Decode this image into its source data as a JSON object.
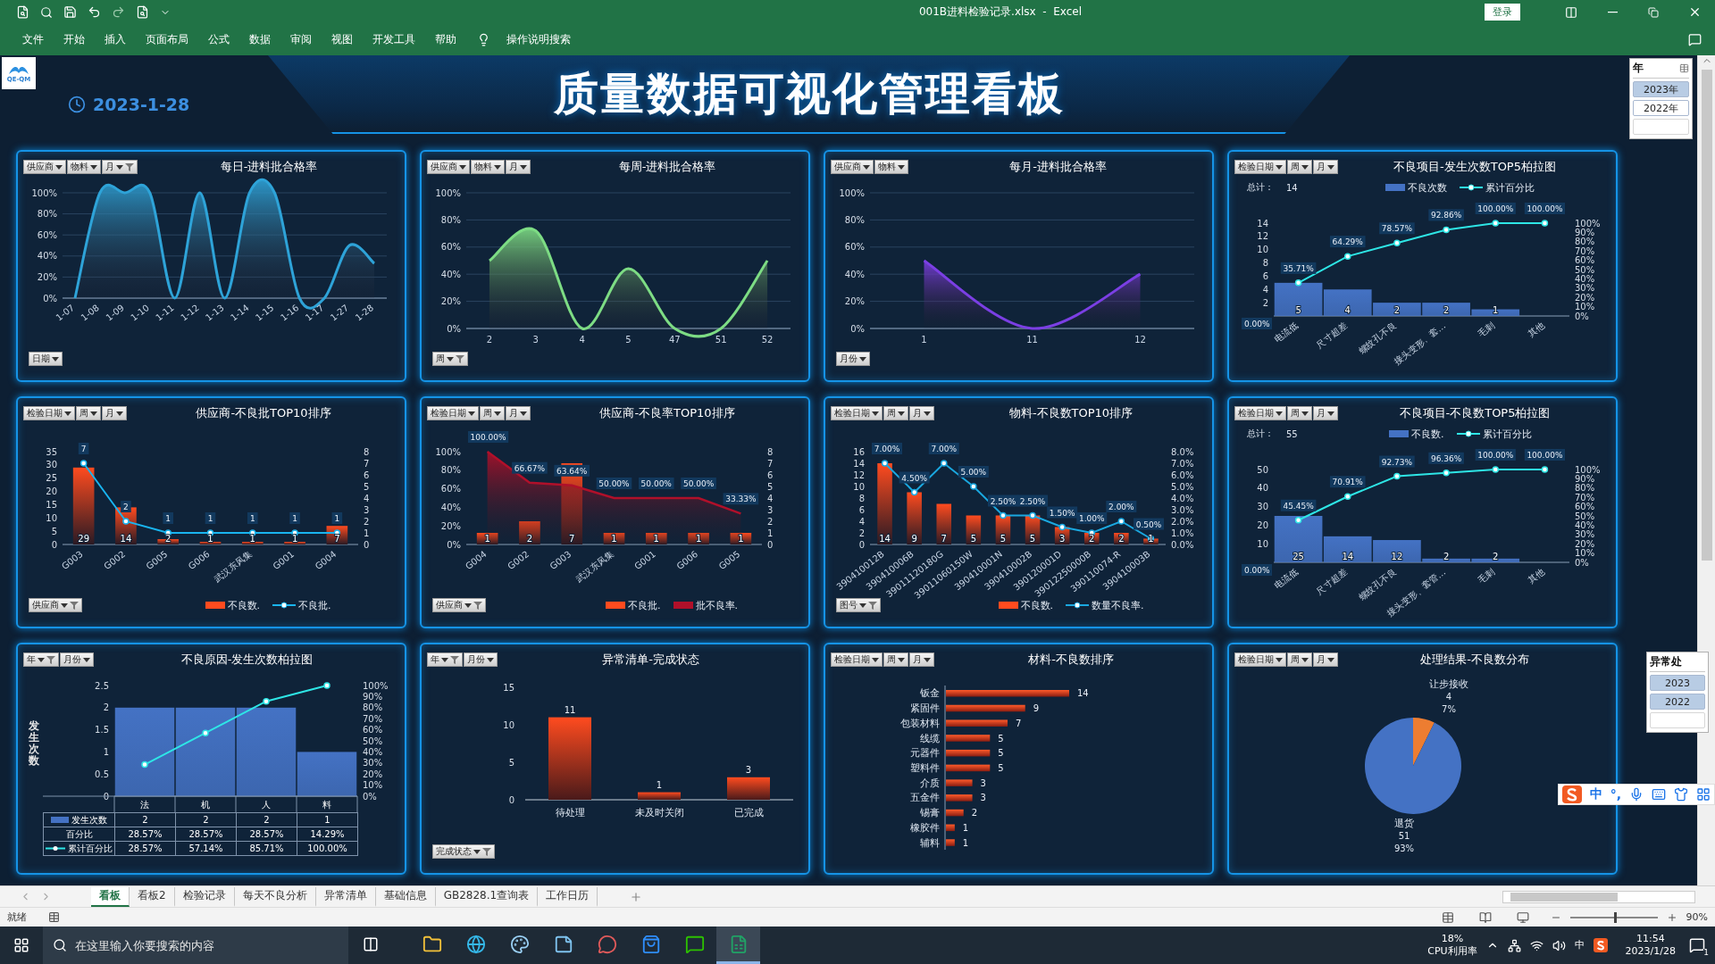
{
  "window": {
    "title": "001B进料检验记录.xlsx  -  Excel",
    "login": "登录"
  },
  "menu": [
    "文件",
    "开始",
    "插入",
    "页面布局",
    "公式",
    "数据",
    "审阅",
    "视图",
    "开发工具",
    "帮助"
  ],
  "tell_me": "操作说明搜索",
  "dashboard": {
    "logo": "QE-QM",
    "date": "2023-1-28",
    "title": "质量数据可视化管理看板"
  },
  "slicers": [
    {
      "title": "年",
      "items": [
        {
          "label": "2023年",
          "selected": true
        },
        {
          "label": "2022年",
          "selected": false
        }
      ]
    },
    {
      "title": "异常处",
      "items": [
        {
          "label": "2023",
          "selected": true
        },
        {
          "label": "2022",
          "selected": true
        }
      ]
    }
  ],
  "panels": [
    {
      "kind": "combo",
      "title": "每日-进料批合格率",
      "filters": [
        {
          "label": "供应商",
          "filtered": false
        },
        {
          "label": "物料",
          "filtered": false
        },
        {
          "label": "月",
          "filtered": true
        }
      ],
      "bottom_filter": {
        "label": "日期",
        "filtered": false
      },
      "chart_data": {
        "type": "area",
        "grid": true,
        "categories": [
          "1-07",
          "1-08",
          "1-09",
          "1-10",
          "1-11",
          "1-12",
          "1-13",
          "1-14",
          "1-15",
          "1-16",
          "1-17",
          "1-27",
          "1-28"
        ],
        "ylim": [
          0,
          100
        ],
        "yticks": [
          {
            "value": 0,
            "label": "0%"
          },
          {
            "value": 20,
            "label": "20%"
          },
          {
            "value": 40,
            "label": "40%"
          },
          {
            "value": 60,
            "label": "60%"
          },
          {
            "value": 80,
            "label": "80%"
          },
          {
            "value": 100,
            "label": "100%"
          }
        ],
        "series": [
          {
            "type": "area",
            "color": "#2ea3d8",
            "values": [
              0,
              100,
              100,
              100,
              0,
              100,
              0,
              100,
              100,
              0,
              0,
              50,
              33
            ]
          }
        ]
      }
    },
    {
      "kind": "combo",
      "title": "每周-进料批合格率",
      "filters": [
        {
          "label": "供应商",
          "filtered": false
        },
        {
          "label": "物料",
          "filtered": false
        },
        {
          "label": "月",
          "filtered": false
        }
      ],
      "bottom_filter": {
        "label": "周",
        "filtered": true
      },
      "chart_data": {
        "type": "area",
        "grid": true,
        "categories": [
          "2",
          "3",
          "4",
          "5",
          "47",
          "51",
          "52"
        ],
        "ylim": [
          0,
          100
        ],
        "yticks": [
          {
            "value": 0,
            "label": "0%"
          },
          {
            "value": 20,
            "label": "20%"
          },
          {
            "value": 40,
            "label": "40%"
          },
          {
            "value": 60,
            "label": "60%"
          },
          {
            "value": 80,
            "label": "80%"
          },
          {
            "value": 100,
            "label": "100%"
          }
        ],
        "series": [
          {
            "type": "area",
            "color": "#7ddc84",
            "values": [
              50,
              72,
              0,
              44,
              0,
              0,
              50
            ]
          }
        ]
      }
    },
    {
      "kind": "combo",
      "title": "每月-进料批合格率",
      "filters": [
        {
          "label": "供应商",
          "filtered": false
        },
        {
          "label": "物料",
          "filtered": false
        }
      ],
      "bottom_filter": {
        "label": "月份",
        "filtered": false
      },
      "chart_data": {
        "type": "area",
        "grid": true,
        "categories": [
          "1",
          "11",
          "12"
        ],
        "ylim": [
          0,
          100
        ],
        "yticks": [
          {
            "value": 0,
            "label": "0%"
          },
          {
            "value": 20,
            "label": "20%"
          },
          {
            "value": 40,
            "label": "40%"
          },
          {
            "value": 60,
            "label": "60%"
          },
          {
            "value": 80,
            "label": "80%"
          },
          {
            "value": 100,
            "label": "100%"
          }
        ],
        "series": [
          {
            "type": "area",
            "color": "#7b3fe4",
            "values": [
              50,
              0,
              40
            ]
          }
        ]
      }
    },
    {
      "kind": "combo",
      "title": "不良项目-发生次数TOP5柏拉图",
      "filters": [
        {
          "label": "检验日期",
          "filtered": false
        },
        {
          "label": "周",
          "filtered": false
        },
        {
          "label": "月",
          "filtered": false
        }
      ],
      "summary": {
        "label": "总计：",
        "value": "14"
      },
      "chart_data": {
        "type": "bar",
        "data_labels": true,
        "categories": [
          "电流低",
          "尺寸超差",
          "螺纹孔不良",
          "接头变形、套…",
          "毛刺",
          "其他"
        ],
        "ylim": [
          0,
          14
        ],
        "yticks": [
          {
            "value": 2,
            "label": "2"
          },
          {
            "value": 4,
            "label": "4"
          },
          {
            "value": 6,
            "label": "6"
          },
          {
            "value": 8,
            "label": "8"
          },
          {
            "value": 10,
            "label": "10"
          },
          {
            "value": 12,
            "label": "12"
          },
          {
            "value": 14,
            "label": "14"
          }
        ],
        "y2lim": [
          0,
          100
        ],
        "y2ticks": [
          {
            "value": 0,
            "label": "0%"
          },
          {
            "value": 10,
            "label": "10%"
          },
          {
            "value": 20,
            "label": "20%"
          },
          {
            "value": 30,
            "label": "30%"
          },
          {
            "value": 40,
            "label": "40%"
          },
          {
            "value": 50,
            "label": "50%"
          },
          {
            "value": 60,
            "label": "60%"
          },
          {
            "value": 70,
            "label": "70%"
          },
          {
            "value": 80,
            "label": "80%"
          },
          {
            "value": 90,
            "label": "90%"
          },
          {
            "value": 100,
            "label": "100%"
          }
        ],
        "series": [
          {
            "name": "不良次数",
            "type": "bar",
            "color": "#4472c4",
            "values": [
              5,
              4,
              2,
              2,
              1,
              null
            ]
          },
          {
            "name": "累计百分比",
            "type": "line",
            "axis": "y2",
            "marker": true,
            "color": "#2ee6e6",
            "values": [
              35.71,
              64.29,
              78.57,
              92.86,
              100,
              100
            ],
            "value_labels": [
              "35.71%",
              "64.29%",
              "78.57%",
              "92.86%",
              "100.00%",
              "100.00%"
            ]
          }
        ],
        "annotations": [
          "0.00%"
        ]
      }
    },
    {
      "kind": "combo",
      "title": "供应商-不良批TOP10排序",
      "filters": [
        {
          "label": "检验日期",
          "filtered": false
        },
        {
          "label": "周",
          "filtered": false
        },
        {
          "label": "月",
          "filtered": false
        }
      ],
      "bottom_filter": {
        "label": "供应商",
        "filtered": true
      },
      "chart_data": {
        "type": "bar",
        "data_labels": true,
        "categories": [
          "G003",
          "G002",
          "G005",
          "G006",
          "武汉东风集",
          "G001",
          "G004"
        ],
        "ylim": [
          0,
          35
        ],
        "yticks": [
          {
            "value": 0,
            "label": "0"
          },
          {
            "value": 5,
            "label": "5"
          },
          {
            "value": 10,
            "label": "10"
          },
          {
            "value": 15,
            "label": "15"
          },
          {
            "value": 20,
            "label": "20"
          },
          {
            "value": 25,
            "label": "25"
          },
          {
            "value": 30,
            "label": "30"
          },
          {
            "value": 35,
            "label": "35"
          }
        ],
        "y2lim": [
          0,
          8
        ],
        "y2ticks": [
          {
            "value": 0,
            "label": "0"
          },
          {
            "value": 1,
            "label": "1"
          },
          {
            "value": 2,
            "label": "2"
          },
          {
            "value": 3,
            "label": "3"
          },
          {
            "value": 4,
            "label": "4"
          },
          {
            "value": 5,
            "label": "5"
          },
          {
            "value": 6,
            "label": "6"
          },
          {
            "value": 7,
            "label": "7"
          },
          {
            "value": 8,
            "label": "8"
          }
        ],
        "series": [
          {
            "name": "不良数.",
            "type": "bar",
            "color": "#ff4b1f",
            "values": [
              29,
              14,
              2,
              1,
              1,
              1,
              7
            ]
          },
          {
            "name": "不良批.",
            "type": "line",
            "axis": "y2",
            "marker": true,
            "color": "#19b5f0",
            "values": [
              7,
              2,
              1,
              1,
              1,
              1,
              1
            ]
          }
        ]
      }
    },
    {
      "kind": "combo",
      "title": "供应商-不良率TOP10排序",
      "filters": [
        {
          "label": "检验日期",
          "filtered": false
        },
        {
          "label": "周",
          "filtered": false
        },
        {
          "label": "月",
          "filtered": false
        }
      ],
      "bottom_filter": {
        "label": "供应商",
        "filtered": true
      },
      "chart_data": {
        "type": "bar",
        "data_labels": true,
        "categories": [
          "G004",
          "G002",
          "G003",
          "武汉东风集",
          "G001",
          "G006",
          "G005"
        ],
        "ylim": [
          0,
          100
        ],
        "yticks": [
          {
            "value": 0,
            "label": "0%"
          },
          {
            "value": 20,
            "label": "20%"
          },
          {
            "value": 40,
            "label": "40%"
          },
          {
            "value": 60,
            "label": "60%"
          },
          {
            "value": 80,
            "label": "80%"
          },
          {
            "value": 100,
            "label": "100%"
          }
        ],
        "y2lim": [
          0,
          8
        ],
        "y2ticks": [
          {
            "value": 0,
            "label": "0"
          },
          {
            "value": 1,
            "label": "1"
          },
          {
            "value": 2,
            "label": "2"
          },
          {
            "value": 3,
            "label": "3"
          },
          {
            "value": 4,
            "label": "4"
          },
          {
            "value": 5,
            "label": "5"
          },
          {
            "value": 6,
            "label": "6"
          },
          {
            "value": 7,
            "label": "7"
          },
          {
            "value": 8,
            "label": "8"
          }
        ],
        "series": [
          {
            "name": "不良批.",
            "type": "bar",
            "axis": "y2",
            "color": "#ff4b1f",
            "values": [
              1,
              2,
              7,
              1,
              1,
              1,
              1
            ]
          },
          {
            "name": "批不良率.",
            "type": "area",
            "color": "#b0102a",
            "values": [
              100,
              66.67,
              63.64,
              50,
              50,
              50,
              33.33
            ],
            "value_labels": [
              "100.00%",
              "66.67%",
              "63.64%",
              "50.00%",
              "50.00%",
              "50.00%",
              "33.33%"
            ]
          }
        ]
      }
    },
    {
      "kind": "combo",
      "title": "物料-不良数TOP10排序",
      "filters": [
        {
          "label": "检验日期",
          "filtered": false
        },
        {
          "label": "周",
          "filtered": false
        },
        {
          "label": "月",
          "filtered": false
        }
      ],
      "bottom_filter": {
        "label": "图号",
        "filtered": true
      },
      "chart_data": {
        "type": "bar",
        "data_labels": true,
        "categories": [
          "390410012B",
          "390410006B",
          "39011120180G",
          "39011060150W",
          "390410001N",
          "390410002B",
          "390120001D",
          "39012250000B",
          "390110074-R",
          "390410003B"
        ],
        "ylim": [
          0,
          16
        ],
        "yticks": [
          {
            "value": 0,
            "label": "0"
          },
          {
            "value": 2,
            "label": "2"
          },
          {
            "value": 4,
            "label": "4"
          },
          {
            "value": 6,
            "label": "6"
          },
          {
            "value": 8,
            "label": "8"
          },
          {
            "value": 10,
            "label": "10"
          },
          {
            "value": 12,
            "label": "12"
          },
          {
            "value": 14,
            "label": "14"
          },
          {
            "value": 16,
            "label": "16"
          }
        ],
        "y2lim": [
          0,
          8
        ],
        "y2ticks": [
          {
            "value": 0,
            "label": "0.0%"
          },
          {
            "value": 1,
            "label": "1.0%"
          },
          {
            "value": 2,
            "label": "2.0%"
          },
          {
            "value": 3,
            "label": "3.0%"
          },
          {
            "value": 4,
            "label": "4.0%"
          },
          {
            "value": 5,
            "label": "5.0%"
          },
          {
            "value": 6,
            "label": "6.0%"
          },
          {
            "value": 7,
            "label": "7.0%"
          },
          {
            "value": 8,
            "label": "8.0%"
          }
        ],
        "series": [
          {
            "name": "不良数.",
            "type": "bar",
            "color": "#ff4b1f",
            "values": [
              14,
              9,
              7,
              5,
              5,
              5,
              3,
              2,
              2,
              1
            ]
          },
          {
            "name": "数量不良率.",
            "type": "line",
            "axis": "y2",
            "marker": true,
            "color": "#1aa8e0",
            "values": [
              7,
              4.5,
              7,
              5,
              2.5,
              2.5,
              1.5,
              1,
              2,
              0.5
            ],
            "value_labels": [
              "7.00%",
              "4.50%",
              "7.00%",
              "5.00%",
              "2.50%",
              "2.50%",
              "1.50%",
              "1.00%",
              "2.00%",
              "0.50%"
            ]
          }
        ]
      }
    },
    {
      "kind": "combo",
      "title": "不良项目-不良数TOP5柏拉图",
      "filters": [
        {
          "label": "检验日期",
          "filtered": false
        },
        {
          "label": "周",
          "filtered": false
        },
        {
          "label": "月",
          "filtered": false
        }
      ],
      "summary": {
        "label": "总计：",
        "value": "55"
      },
      "chart_data": {
        "type": "bar",
        "data_labels": true,
        "categories": [
          "电流低",
          "尺寸超差",
          "螺纹孔不良",
          "接头变形、套管…",
          "毛刺",
          "其他"
        ],
        "ylim": [
          0,
          50
        ],
        "yticks": [
          {
            "value": 10,
            "label": "10"
          },
          {
            "value": 20,
            "label": "20"
          },
          {
            "value": 30,
            "label": "30"
          },
          {
            "value": 40,
            "label": "40"
          },
          {
            "value": 50,
            "label": "50"
          }
        ],
        "y2lim": [
          0,
          100
        ],
        "y2ticks": [
          {
            "value": 0,
            "label": "0%"
          },
          {
            "value": 10,
            "label": "10%"
          },
          {
            "value": 20,
            "label": "20%"
          },
          {
            "value": 30,
            "label": "30%"
          },
          {
            "value": 40,
            "label": "40%"
          },
          {
            "value": 50,
            "label": "50%"
          },
          {
            "value": 60,
            "label": "60%"
          },
          {
            "value": 70,
            "label": "70%"
          },
          {
            "value": 80,
            "label": "80%"
          },
          {
            "value": 90,
            "label": "90%"
          },
          {
            "value": 100,
            "label": "100%"
          }
        ],
        "series": [
          {
            "name": "不良数.",
            "type": "bar",
            "color": "#4472c4",
            "values": [
              25,
              14,
              12,
              2,
              2,
              null
            ]
          },
          {
            "name": "累计百分比",
            "type": "line",
            "axis": "y2",
            "marker": true,
            "color": "#2ee6e6",
            "values": [
              45.45,
              70.91,
              92.73,
              96.36,
              100,
              100
            ],
            "value_labels": [
              "45.45%",
              "70.91%",
              "92.73%",
              "96.36%",
              "100.00%",
              "100.00%"
            ]
          }
        ],
        "annotations": [
          "0.00%"
        ]
      }
    },
    {
      "kind": "table-combo",
      "title": "不良原因-发生次数柏拉图",
      "filters": [
        {
          "label": "年",
          "filtered": true
        },
        {
          "label": "月份",
          "filtered": false
        }
      ],
      "chart_data": {
        "type": "bar",
        "ylabel": "发生次数",
        "categories": [
          "法",
          "机",
          "人",
          "料"
        ],
        "ylim": [
          0,
          2.5
        ],
        "yticks": [
          {
            "value": 0,
            "label": "0"
          },
          {
            "value": 0.5,
            "label": "0.5"
          },
          {
            "value": 1,
            "label": "1"
          },
          {
            "value": 1.5,
            "label": "1.5"
          },
          {
            "value": 2,
            "label": "2"
          },
          {
            "value": 2.5,
            "label": "2.5"
          }
        ],
        "y2lim": [
          0,
          100
        ],
        "y2ticks": [
          {
            "value": 0,
            "label": "0%"
          },
          {
            "value": 10,
            "label": "10%"
          },
          {
            "value": 20,
            "label": "20%"
          },
          {
            "value": 30,
            "label": "30%"
          },
          {
            "value": 40,
            "label": "40%"
          },
          {
            "value": 50,
            "label": "50%"
          },
          {
            "value": 60,
            "label": "60%"
          },
          {
            "value": 70,
            "label": "70%"
          },
          {
            "value": 80,
            "label": "80%"
          },
          {
            "value": 90,
            "label": "90%"
          },
          {
            "value": 100,
            "label": "100%"
          }
        ],
        "series": [
          {
            "name": "发生次数",
            "type": "bar",
            "color": "#4472c4",
            "values": [
              2,
              2,
              2,
              1
            ]
          },
          {
            "name": "累计百分比",
            "type": "line",
            "axis": "y2",
            "marker": true,
            "color": "#2ee6e6",
            "values": [
              28.57,
              57.14,
              85.71,
              100
            ]
          }
        ]
      },
      "data_table": [
        {
          "kind": "bar",
          "values": [
            "2",
            "2",
            "2",
            "1"
          ]
        },
        {
          "kind": "plain",
          "label": "百分比",
          "values": [
            "28.57%",
            "28.57%",
            "28.57%",
            "14.29%"
          ]
        },
        {
          "kind": "line",
          "values": [
            "28.57%",
            "57.14%",
            "85.71%",
            "100.00%"
          ]
        }
      ]
    },
    {
      "kind": "bar3d",
      "title": "异常清单-完成状态",
      "filters": [
        {
          "label": "年",
          "filtered": true
        },
        {
          "label": "月份",
          "filtered": false
        }
      ],
      "bottom_filter": {
        "label": "完成状态",
        "filtered": true
      },
      "chart_data": {
        "type": "bar",
        "data_labels": true,
        "categories": [
          "待处理",
          "未及时关闭",
          "已完成"
        ],
        "values": [
          11,
          1,
          3
        ],
        "ylim": [
          0,
          15
        ],
        "yticks": [
          0,
          5,
          10,
          15
        ]
      }
    },
    {
      "kind": "hbar",
      "title": "材料-不良数排序",
      "filters": [
        {
          "label": "检验日期",
          "filtered": false
        },
        {
          "label": "周",
          "filtered": false
        },
        {
          "label": "月",
          "filtered": false
        }
      ],
      "chart_data": {
        "type": "bar",
        "orientation": "horizontal",
        "data_labels": true,
        "categories": [
          "钣金",
          "紧固件",
          "包装材料",
          "线缆",
          "元器件",
          "塑料件",
          "介质",
          "五金件",
          "锡膏",
          "橡胶件",
          "辅料"
        ],
        "values": [
          14,
          9,
          7,
          5,
          5,
          5,
          3,
          3,
          2,
          1,
          1
        ]
      }
    },
    {
      "kind": "pie",
      "title": "处理结果-不良数分布",
      "filters": [
        {
          "label": "检验日期",
          "filtered": false
        },
        {
          "label": "周",
          "filtered": false
        },
        {
          "label": "月",
          "filtered": false
        }
      ],
      "chart_data": {
        "type": "pie",
        "data_labels": true,
        "categories": [
          "让步接收",
          "退货"
        ],
        "values": [
          4,
          51
        ],
        "colors": [
          "#ed7d31",
          "#4472c4"
        ],
        "value_labels": [
          "4",
          "51"
        ],
        "annotations": [
          {
            "text": "7%"
          },
          {
            "text": "93%"
          }
        ]
      }
    }
  ],
  "sheet_tabs": [
    {
      "label": "看板",
      "selected": true
    },
    {
      "label": "看板2",
      "selected": false
    },
    {
      "label": "检验记录",
      "selected": false
    },
    {
      "label": "每天不良分析",
      "selected": false
    },
    {
      "label": "异常清单",
      "selected": false
    },
    {
      "label": "基础信息",
      "selected": false
    },
    {
      "label": "GB2828.1查询表",
      "selected": false
    },
    {
      "label": "工作日历",
      "selected": false
    }
  ],
  "status_bar": {
    "status": "就绪",
    "zoom": {
      "level": 0.5,
      "reading": "90%"
    }
  },
  "ime": {
    "mode": "中",
    "punctuation": "°,"
  },
  "taskbar": {
    "search_placeholder": "在这里输入你要搜索的内容",
    "apps": [
      {
        "kind": "folder",
        "selected": false
      },
      {
        "kind": "browser",
        "selected": false
      },
      {
        "kind": "paint",
        "selected": false
      },
      {
        "kind": "notes",
        "selected": false
      },
      {
        "kind": "chat",
        "selected": false
      },
      {
        "kind": "store",
        "selected": false
      },
      {
        "kind": "wechat",
        "selected": false
      },
      {
        "kind": "spreadsheet",
        "selected": true
      }
    ],
    "cpu": "18%",
    "cpu_label": "CPU利用率",
    "ime": "中",
    "time": "11:54",
    "date": "2023/1/28",
    "notifications": "1"
  }
}
